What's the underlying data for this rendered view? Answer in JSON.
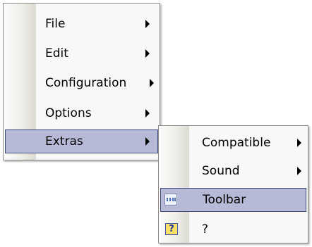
{
  "main_menu": {
    "items": [
      {
        "label": "File",
        "has_submenu": true
      },
      {
        "label": "Edit",
        "has_submenu": true
      },
      {
        "label": "Configuration",
        "has_submenu": true
      },
      {
        "label": "Options",
        "has_submenu": true
      },
      {
        "label": "Extras",
        "has_submenu": true,
        "highlighted": true
      }
    ]
  },
  "submenu": {
    "items": [
      {
        "label": "Compatible",
        "has_submenu": true
      },
      {
        "label": "Sound",
        "has_submenu": true
      },
      {
        "label": "Toolbar",
        "icon": "toolbar-icon",
        "highlighted": true
      },
      {
        "label": "?",
        "icon": "help-icon"
      }
    ]
  },
  "colors": {
    "highlight_fill": "#b7bad6",
    "highlight_border": "#3d4a7c",
    "menu_background": "#f8f8f6",
    "menu_border": "#8a8a8a"
  }
}
